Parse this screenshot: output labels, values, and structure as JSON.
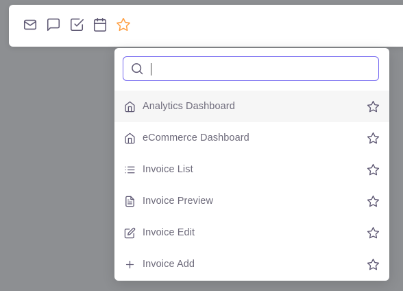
{
  "colors": {
    "backdrop": "#8d8f92",
    "accent": "#7367f0",
    "bookmark_active": "#ff9f43",
    "icon": "#5e5873",
    "text": "#6e6b7b"
  },
  "navbar": {
    "icons": [
      {
        "name": "mail-icon",
        "active": false
      },
      {
        "name": "chat-icon",
        "active": false
      },
      {
        "name": "todo-icon",
        "active": false
      },
      {
        "name": "calendar-icon",
        "active": false
      },
      {
        "name": "star-icon",
        "active": true
      }
    ]
  },
  "bookmark_search": {
    "value": "",
    "placeholder": "",
    "results": [
      {
        "label": "Analytics Dashboard",
        "icon": "home-icon",
        "highlighted": true
      },
      {
        "label": "eCommerce Dashboard",
        "icon": "home-icon",
        "highlighted": false
      },
      {
        "label": "Invoice List",
        "icon": "list-icon",
        "highlighted": false
      },
      {
        "label": "Invoice Preview",
        "icon": "file-text-icon",
        "highlighted": false
      },
      {
        "label": "Invoice Edit",
        "icon": "edit-icon",
        "highlighted": false
      },
      {
        "label": "Invoice Add",
        "icon": "plus-icon",
        "highlighted": false
      }
    ]
  }
}
